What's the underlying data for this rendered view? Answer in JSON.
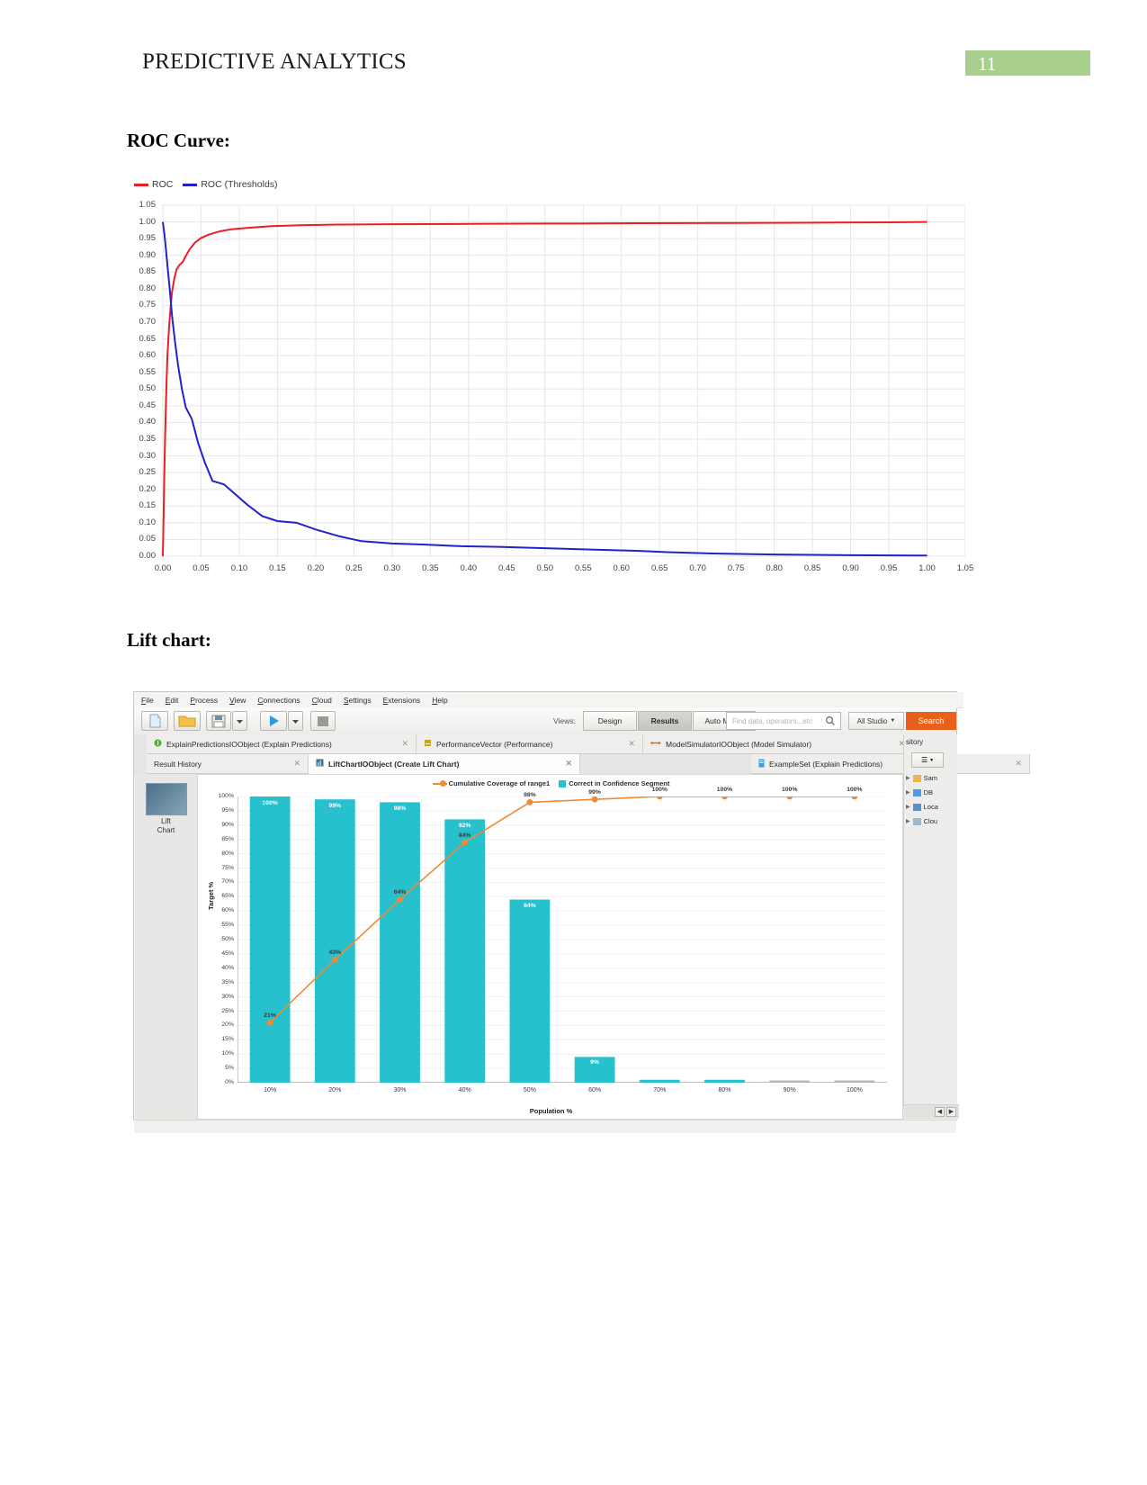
{
  "header": {
    "title": "PREDICTIVE ANALYTICS",
    "page_number": "11",
    "badge_color": "#a9cf8f"
  },
  "sections": {
    "roc_title": "ROC Curve:",
    "lift_title": "Lift chart:"
  },
  "chart_data": [
    {
      "type": "line",
      "title": "ROC Curve",
      "xlabel": "",
      "ylabel": "",
      "xlim": [
        0.0,
        1.05
      ],
      "ylim": [
        0.0,
        1.05
      ],
      "grid": true,
      "legend_position": "top-left",
      "xticks": [
        "0.00",
        "0.05",
        "0.10",
        "0.15",
        "0.20",
        "0.25",
        "0.30",
        "0.35",
        "0.40",
        "0.45",
        "0.50",
        "0.55",
        "0.60",
        "0.65",
        "0.70",
        "0.75",
        "0.80",
        "0.85",
        "0.90",
        "0.95",
        "1.00",
        "1.05"
      ],
      "yticks": [
        "0.00",
        "0.05",
        "0.10",
        "0.15",
        "0.20",
        "0.25",
        "0.30",
        "0.35",
        "0.40",
        "0.45",
        "0.50",
        "0.55",
        "0.60",
        "0.65",
        "0.70",
        "0.75",
        "0.80",
        "0.85",
        "0.90",
        "0.95",
        "1.00",
        "1.05"
      ],
      "series": [
        {
          "name": "ROC",
          "color": "#ee1c25",
          "x": [
            0.0,
            0.001,
            0.002,
            0.003,
            0.004,
            0.005,
            0.006,
            0.008,
            0.01,
            0.012,
            0.015,
            0.018,
            0.022,
            0.026,
            0.03,
            0.035,
            0.042,
            0.05,
            0.06,
            0.075,
            0.09,
            0.11,
            0.14,
            0.18,
            0.23,
            0.3,
            0.4,
            0.5,
            0.62,
            0.75,
            0.88,
            0.95,
            1.0
          ],
          "y": [
            0.0,
            0.12,
            0.25,
            0.36,
            0.45,
            0.53,
            0.6,
            0.68,
            0.74,
            0.79,
            0.83,
            0.858,
            0.872,
            0.88,
            0.898,
            0.918,
            0.938,
            0.952,
            0.962,
            0.972,
            0.978,
            0.982,
            0.987,
            0.99,
            0.992,
            0.993,
            0.994,
            0.995,
            0.996,
            0.997,
            0.998,
            0.999,
            1.0
          ]
        },
        {
          "name": "ROC (Thresholds)",
          "color": "#2222cc",
          "x": [
            0.0,
            0.002,
            0.004,
            0.006,
            0.009,
            0.012,
            0.016,
            0.02,
            0.025,
            0.03,
            0.038,
            0.046,
            0.055,
            0.065,
            0.08,
            0.095,
            0.11,
            0.13,
            0.15,
            0.175,
            0.2,
            0.23,
            0.26,
            0.3,
            0.34,
            0.39,
            0.44,
            0.5,
            0.56,
            0.62,
            0.66,
            0.72,
            0.8,
            0.9,
            1.0
          ],
          "y": [
            1.0,
            0.965,
            0.92,
            0.87,
            0.8,
            0.72,
            0.64,
            0.57,
            0.5,
            0.445,
            0.41,
            0.34,
            0.28,
            0.225,
            0.215,
            0.185,
            0.155,
            0.12,
            0.105,
            0.1,
            0.08,
            0.06,
            0.045,
            0.038,
            0.035,
            0.03,
            0.028,
            0.024,
            0.02,
            0.016,
            0.012,
            0.008,
            0.005,
            0.003,
            0.002
          ]
        }
      ]
    },
    {
      "type": "bar",
      "title": "Lift Chart",
      "xlabel": "Population %",
      "ylabel": "Target %",
      "ylim": [
        0,
        100
      ],
      "grid": true,
      "legend_position": "top-center",
      "categories": [
        "10%",
        "20%",
        "30%",
        "40%",
        "50%",
        "60%",
        "70%",
        "80%",
        "90%",
        "100%"
      ],
      "yticks": [
        "100%",
        "95%",
        "90%",
        "85%",
        "80%",
        "75%",
        "70%",
        "65%",
        "60%",
        "55%",
        "50%",
        "45%",
        "40%",
        "35%",
        "30%",
        "25%",
        "20%",
        "15%",
        "10%",
        "5%",
        "0%"
      ],
      "series": [
        {
          "name": "Correct in Confidence Segment",
          "type": "bar",
          "color": "#27c0cd",
          "values": [
            100,
            99,
            98,
            92,
            64,
            9,
            1,
            1,
            0,
            0
          ],
          "labels": [
            "100%",
            "99%",
            "98%",
            "92%",
            "64%",
            "9%",
            "",
            "",
            "",
            ""
          ]
        },
        {
          "name": "Cumulative Coverage of range1",
          "type": "line",
          "color": "#f08a33",
          "values": [
            21,
            43,
            64,
            84,
            98,
            99,
            100,
            100,
            100,
            100
          ],
          "labels": [
            "21%",
            "43%",
            "64%",
            "84%",
            "98%",
            "99%",
            "100%",
            "100%",
            "100%",
            "100%"
          ]
        }
      ]
    }
  ],
  "rapidminer": {
    "menu": [
      "File",
      "Edit",
      "Process",
      "View",
      "Connections",
      "Cloud",
      "Settings",
      "Extensions",
      "Help"
    ],
    "toolbar": {
      "views_label": "Views:",
      "design_label": "Design",
      "results_label": "Results",
      "auto_model_label": "Auto Model",
      "search_placeholder": "Find data, operators...etc",
      "scope_label": "All Studio",
      "search_button": "Search"
    },
    "tabs_top": [
      {
        "label": "ExplainPredictionsIOObject (Explain Predictions)",
        "close": "✕"
      },
      {
        "label": "PerformanceVector (Performance)",
        "close": "✕"
      },
      {
        "label": "ModelSimulatorIOObject (Model Simulator)",
        "close": "✕"
      }
    ],
    "tabs_bottom": [
      {
        "label": "Result History",
        "close": "✕"
      },
      {
        "label": "LiftChartIOObject (Create Lift Chart)",
        "close": "✕"
      },
      {
        "label": "ExampleSet (Explain Predictions)",
        "close": "✕"
      }
    ],
    "left_panel": {
      "label_line1": "Lift",
      "label_line2": "Chart"
    },
    "right_panel": {
      "title": "sitory",
      "items": [
        {
          "label": "Sam",
          "color": "#e8b74e"
        },
        {
          "label": "DB",
          "color": "#4e9be8"
        },
        {
          "label": "Loca",
          "color": "#5b8fc9"
        },
        {
          "label": "Clou",
          "color": "#9ab8cf"
        }
      ]
    }
  }
}
